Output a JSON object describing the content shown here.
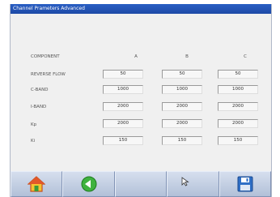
{
  "window": {
    "title": "Channel Prameters Advanced"
  },
  "table": {
    "corner_label": "COMPONENT",
    "columns": [
      "A",
      "B",
      "C"
    ],
    "rows": [
      {
        "label": "REVERSE FLOW",
        "values": [
          "50",
          "50",
          "50"
        ]
      },
      {
        "label": "C-BAND",
        "values": [
          "1000",
          "1000",
          "1000"
        ]
      },
      {
        "label": "I-BAND",
        "values": [
          "2000",
          "2000",
          "2000"
        ]
      },
      {
        "label": "Kp",
        "values": [
          "2000",
          "2000",
          "2000"
        ]
      },
      {
        "label": "Ki",
        "values": [
          "150",
          "150",
          "150"
        ]
      }
    ]
  },
  "toolbar": {
    "buttons": [
      {
        "icon": "home-icon"
      },
      {
        "icon": "back-arrow-icon"
      },
      {
        "icon": ""
      },
      {
        "icon": ""
      },
      {
        "icon": "save-icon"
      }
    ]
  },
  "colors": {
    "title_bar": "#1d49a6",
    "toolbar": "#bfcbe0",
    "panel": "#f0f0f0"
  }
}
